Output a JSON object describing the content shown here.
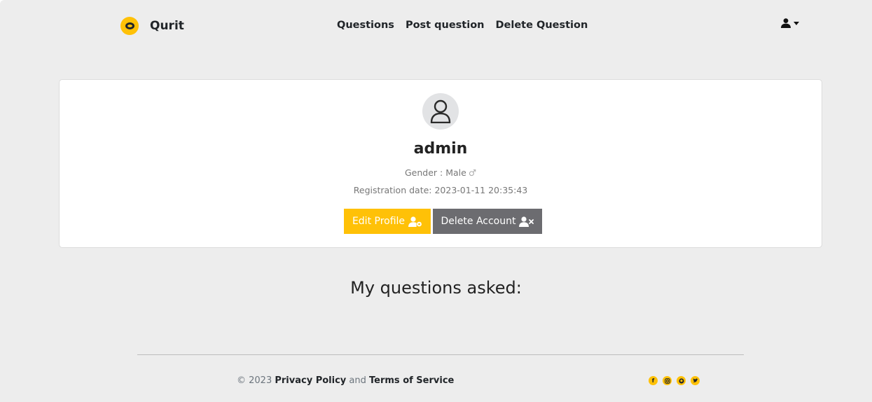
{
  "brand": {
    "name": "Qurit",
    "logo_icon": "qurit-logo-icon"
  },
  "nav": {
    "links": [
      "Questions",
      "Post question",
      "Delete Question"
    ]
  },
  "user_menu": {
    "icon": "user-icon"
  },
  "profile": {
    "username": "admin",
    "gender_label": "Gender : Male",
    "gender_symbol": "♂",
    "registration": "Registration date: 2023-01-11 20:35:43",
    "edit_button": "Edit Profile",
    "delete_button": "Delete Account"
  },
  "section": {
    "title": "My questions asked:"
  },
  "footer": {
    "copyright": "© 2023",
    "privacy": "Privacy Policy",
    "and": "and",
    "terms": "Terms of Service",
    "socials": [
      "facebook-icon",
      "instagram-icon",
      "github-icon",
      "twitter-icon"
    ]
  },
  "colors": {
    "accent": "#ffc107",
    "secondary": "#6c6c70",
    "background": "#ededed"
  }
}
